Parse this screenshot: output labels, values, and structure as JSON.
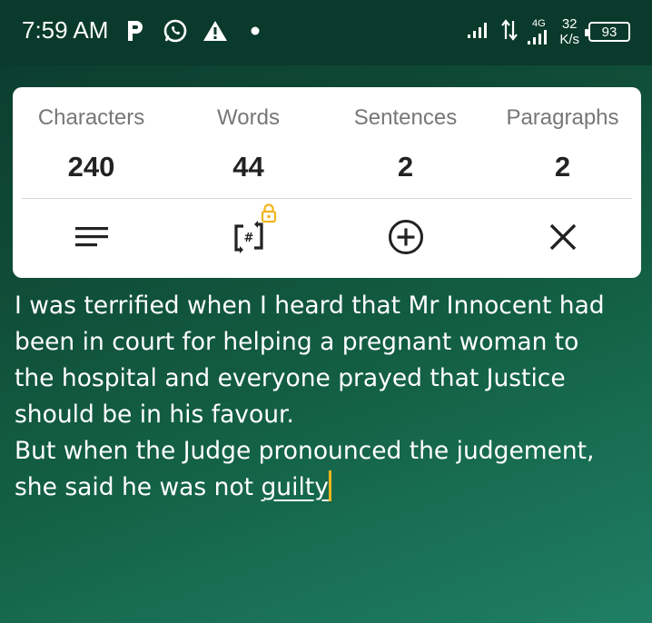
{
  "status_bar": {
    "time": "7:59 AM",
    "network_type": "4G",
    "speed_value": "32",
    "speed_unit": "K/s",
    "battery": "93",
    "icons": [
      "p-icon",
      "whatsapp-icon",
      "warning-icon",
      "dot-icon",
      "signal-icon",
      "data-arrows-icon",
      "signal-4g-icon",
      "battery-icon"
    ]
  },
  "stats": {
    "characters_label": "Characters",
    "characters_value": "240",
    "words_label": "Words",
    "words_value": "44",
    "sentences_label": "Sentences",
    "sentences_value": "2",
    "paragraphs_label": "Paragraphs",
    "paragraphs_value": "2"
  },
  "toolbar": {
    "icons": [
      "menu-lines-icon",
      "hash-swap-icon",
      "lock-icon",
      "add-circle-icon",
      "close-icon"
    ],
    "accent_color": "#f2b51c"
  },
  "editor": {
    "line1": "I was terrified when I heard that Mr Innocent had",
    "line2": "been in court for helping a pregnant woman to",
    "line3": "the hospital and everyone prayed that Justice",
    "line4": "should be in his favour.",
    "line5": "But when the Judge pronounced the judgement,",
    "line6_prefix": "she said he was not ",
    "line6_underlined": "guilty"
  },
  "colors": {
    "background": "#0f4a36",
    "card": "#ffffff",
    "caret": "#f2b51c"
  }
}
